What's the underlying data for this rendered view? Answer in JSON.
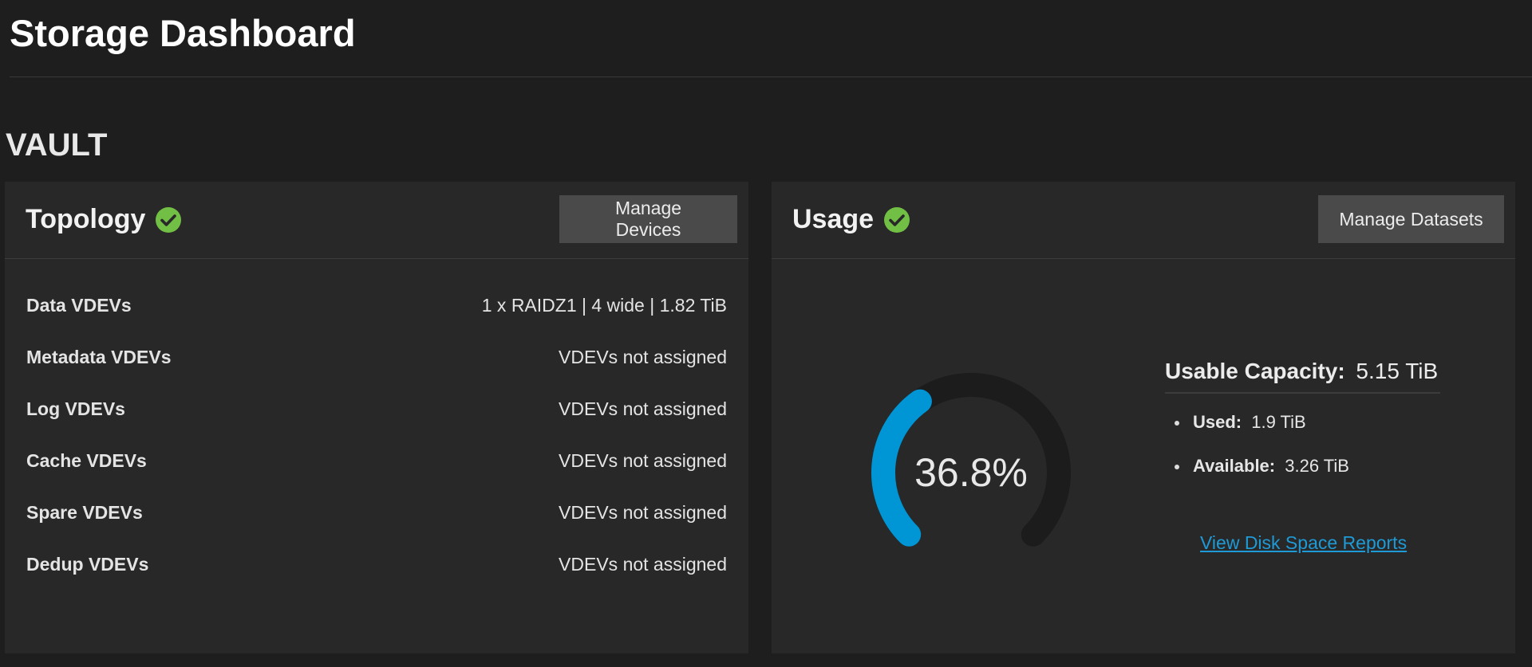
{
  "page": {
    "title": "Storage Dashboard"
  },
  "pool": {
    "name": "VAULT"
  },
  "topology": {
    "title": "Topology",
    "status_icon": "check-circle-icon",
    "manage_button": "Manage Devices",
    "rows": [
      {
        "label": "Data VDEVs",
        "value": "1 x RAIDZ1 | 4 wide | 1.82 TiB"
      },
      {
        "label": "Metadata VDEVs",
        "value": "VDEVs not assigned"
      },
      {
        "label": "Log VDEVs",
        "value": "VDEVs not assigned"
      },
      {
        "label": "Cache VDEVs",
        "value": "VDEVs not assigned"
      },
      {
        "label": "Spare VDEVs",
        "value": "VDEVs not assigned"
      },
      {
        "label": "Dedup VDEVs",
        "value": "VDEVs not assigned"
      }
    ]
  },
  "usage": {
    "title": "Usage",
    "status_icon": "check-circle-icon",
    "manage_button": "Manage Datasets",
    "gauge_text": "36.8%",
    "used_fraction": 0.368,
    "capacity_label": "Usable Capacity:",
    "capacity_value": "5.15 TiB",
    "used_label": "Used:",
    "used_value": "1.9 TiB",
    "available_label": "Available:",
    "available_value": "3.26 TiB",
    "report_link": "View Disk Space Reports"
  },
  "colors": {
    "background": "#1e1e1e",
    "card": "#282828",
    "status_ok": "#71bf44",
    "gauge_used": "#0095d5",
    "gauge_track": "#1c1c1c",
    "link": "#1e9ad6"
  }
}
